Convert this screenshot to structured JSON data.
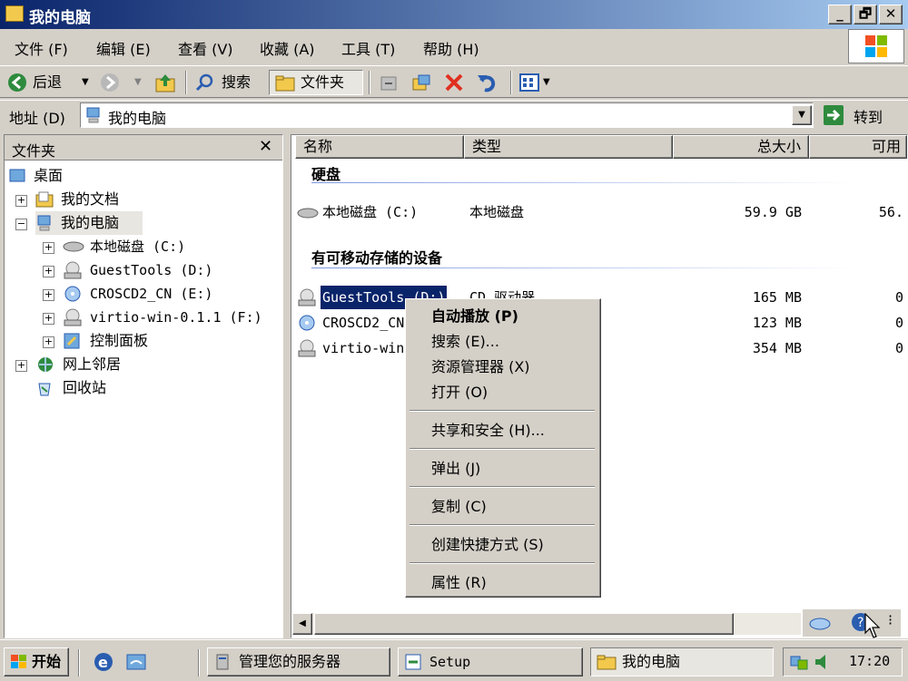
{
  "window": {
    "title": "我的电脑"
  },
  "window_buttons": [
    "_",
    "🗗",
    "✕"
  ],
  "menu": [
    "文件 (F)",
    "编辑 (E)",
    "查看 (V)",
    "收藏 (A)",
    "工具 (T)",
    "帮助 (H)"
  ],
  "toolbar": {
    "back": "后退",
    "search": "搜索",
    "folders": "文件夹"
  },
  "address": {
    "label": "地址 (D)",
    "value": "我的电脑",
    "go": "转到"
  },
  "left_pane": {
    "title": "文件夹",
    "tree": [
      {
        "label": "桌面"
      },
      {
        "label": "我的文档"
      },
      {
        "label": "我的电脑"
      },
      {
        "label": "本地磁盘 (C:)"
      },
      {
        "label": "GuestTools (D:)"
      },
      {
        "label": "CROSCD2_CN (E:)"
      },
      {
        "label": "virtio-win-0.1.1 (F:)"
      },
      {
        "label": "控制面板"
      },
      {
        "label": "网上邻居"
      },
      {
        "label": "回收站"
      }
    ]
  },
  "columns": [
    "名称",
    "类型",
    "总大小",
    "可用"
  ],
  "groups": {
    "hard_disks": "硬盘",
    "removable": "有可移动存储的设备"
  },
  "drives": [
    {
      "name": "本地磁盘 (C:)",
      "type": "本地磁盘",
      "size": "59.9 GB",
      "free": "56."
    },
    {
      "name": "GuestTools (D:)",
      "type": "CD 驱动器",
      "size": "165 MB",
      "free": "0"
    },
    {
      "name": "CROSCD2_CN",
      "type": "",
      "size": "123 MB",
      "free": "0"
    },
    {
      "name": "virtio-win",
      "type": "",
      "size": "354 MB",
      "free": "0"
    }
  ],
  "context_menu": [
    {
      "label": "自动播放 (P)"
    },
    {
      "label": "搜索 (E)..."
    },
    {
      "label": "资源管理器 (X)"
    },
    {
      "label": "打开 (O)"
    },
    {
      "label": "共享和安全 (H)..."
    },
    {
      "label": "弹出 (J)"
    },
    {
      "label": "复制 (C)"
    },
    {
      "label": "创建快捷方式 (S)"
    },
    {
      "label": "属性 (R)"
    }
  ],
  "taskbar": {
    "start": "开始",
    "tasks": [
      "管理您的服务器",
      "Setup",
      "我的电脑"
    ],
    "clock": "17:20"
  },
  "colors": {
    "title_start": "#0a246a",
    "title_end": "#a6caf0",
    "selection": "#0a246a",
    "face": "#d4d0c8"
  }
}
